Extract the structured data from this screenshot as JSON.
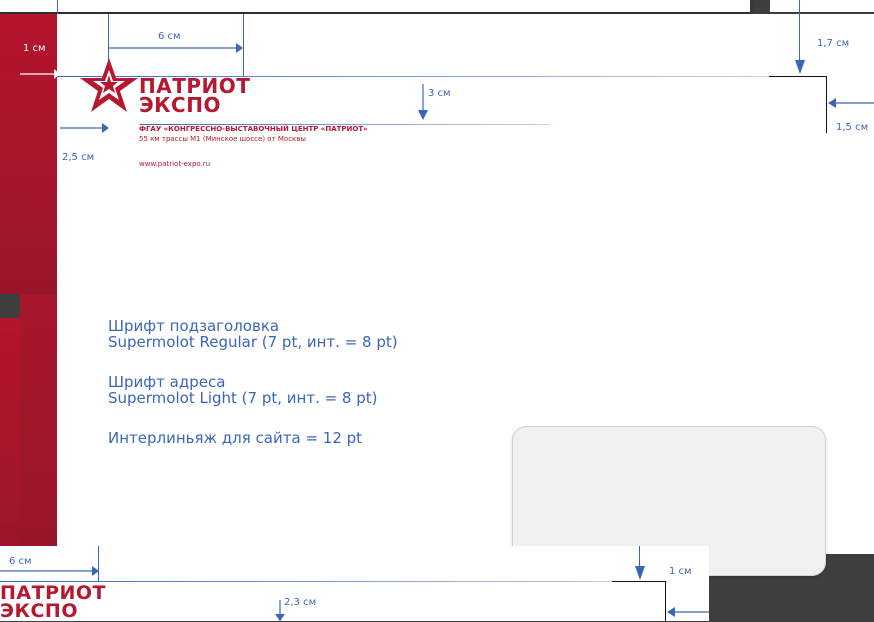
{
  "brand": {
    "line1": "ПАТРИОТ",
    "line2": "ЭКСПО",
    "color": "#b6182f",
    "logo": "star-icon"
  },
  "letterhead": {
    "org_name": "ФГАУ «КОНГРЕССНО-ВЫСТАВОЧНЫЙ ЦЕНТР «ПАТРИОТ»",
    "address": "55 км трассы М1 (Минское шоссе) от Москвы",
    "website": "www.patriot-expo.ru"
  },
  "dimensions_top": {
    "left_margin": "1 см",
    "logo_offset": "6 см",
    "top_right": "1,7 см",
    "text_drop": "3 см",
    "left_logo": "2,5 см",
    "right_margin": "1,5 см"
  },
  "dimensions_bottom": {
    "logo_offset": "6 см",
    "top_right": "1 см",
    "text_drop": "2,3 см"
  },
  "specs": {
    "subtitle_font_label": "Шрифт подзаголовка",
    "subtitle_font_value": "Supermolot Regular (7 pt, инт. = 8 pt)",
    "address_font_label": "Шрифт адреса",
    "address_font_value": "Supermolot Light (7 pt, инт. = 8 pt)",
    "site_leading": "Интерлиньяж для сайта = 12 pt"
  },
  "colors": {
    "accent_blue": "#3b66b8",
    "brand_red": "#b6182f",
    "background": "#3e3e3e"
  }
}
